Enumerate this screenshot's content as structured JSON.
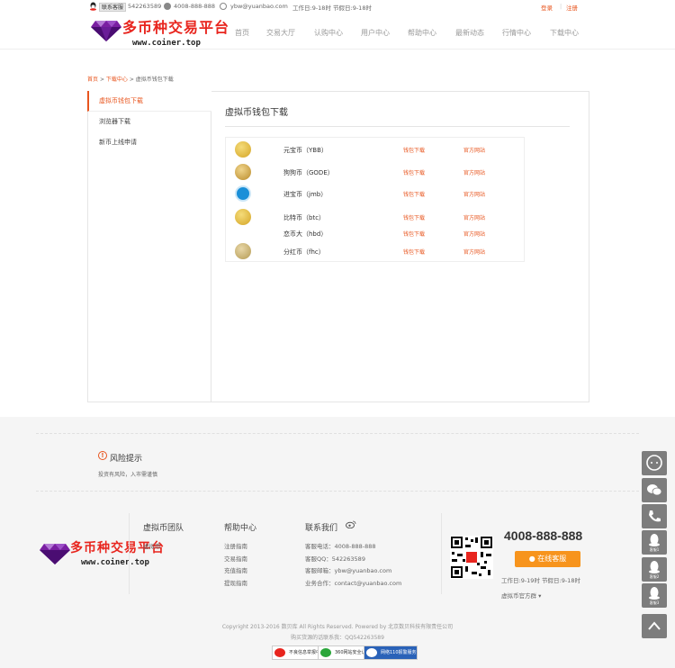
{
  "topbar": {
    "service_label": "联系客服",
    "qq": "542263589",
    "phone": "4008-888-888",
    "email": "ybw@yuanbao.com",
    "hours": "工作日:9-18时 节假日:9-18时",
    "login": "登录",
    "register": "注册"
  },
  "logo": {
    "title": "多币种交易平台",
    "url": "www.coiner.top"
  },
  "nav": [
    "首页",
    "交易大厅",
    "认购中心",
    "用户中心",
    "帮助中心",
    "最新动态",
    "行情中心",
    "下载中心"
  ],
  "breadcrumb": {
    "home": "首页",
    "section": "下载中心",
    "current": "虚拟币钱包下载",
    "sep": ">"
  },
  "sidebar": {
    "items": [
      {
        "label": "虚拟币钱包下载",
        "active": true
      },
      {
        "label": "浏览器下载",
        "active": false
      },
      {
        "label": "新币上线申请",
        "active": false
      }
    ]
  },
  "main": {
    "title": "虚拟币钱包下载",
    "wallets": [
      {
        "name": "元宝币（YBB）",
        "download": "钱包下载",
        "site": "官方网站",
        "coin": "gold"
      },
      {
        "name": "狗狗币（GODE）",
        "download": "钱包下载",
        "site": "官方网站",
        "coin": "doge"
      },
      {
        "name": "进宝币（jmb）",
        "download": "钱包下载",
        "site": "官方网站",
        "coin": "blue"
      },
      {
        "name": "比特币（btc）",
        "download": "钱包下载",
        "site": "官方网站",
        "coin": "gold"
      },
      {
        "name": "恋币大（hbd）",
        "download": "钱包下载",
        "site": "官方网站",
        "coin": "none"
      },
      {
        "name": "分红币（fhc）",
        "download": "钱包下载",
        "site": "官方网站",
        "coin": "tan"
      }
    ]
  },
  "risk": {
    "title": "风险提示",
    "text": "投资有风险，入市需谨慎"
  },
  "footer": {
    "team_title": "虚拟币团队",
    "team_links": [
      "虚拟币"
    ],
    "help_title": "帮助中心",
    "help_links": [
      "注册指南",
      "交易指南",
      "充值指南",
      "提现指南"
    ],
    "contact_title": "联系我们",
    "contact_lines": [
      "客服电话：4008-888-888",
      "客服QQ：542263589",
      "客服邮箱：ybw@yuanbao.com",
      "业务合作：contact@yuanbao.com"
    ],
    "phone": "4008-888-888",
    "cs_button": "在线客服",
    "hours": "工作日:9-19时 节假日:9-18时",
    "group": "虚拟币官方群",
    "copyright": "Copyright 2013-2016 数贝库 All Rights Reserved. Powered by 北京数贝科技有限责任公司",
    "icp": "购买货源的话联系我：QQ542263589",
    "badges": [
      "不良信息举报中心",
      "360网站安全认证",
      "网络110报警服务"
    ]
  },
  "float_bar": [
    "客服1",
    "客服2",
    "客服3"
  ],
  "colors": {
    "accent": "#e8551e",
    "orange_button": "#f7941d",
    "band": "#f5f5f5"
  }
}
